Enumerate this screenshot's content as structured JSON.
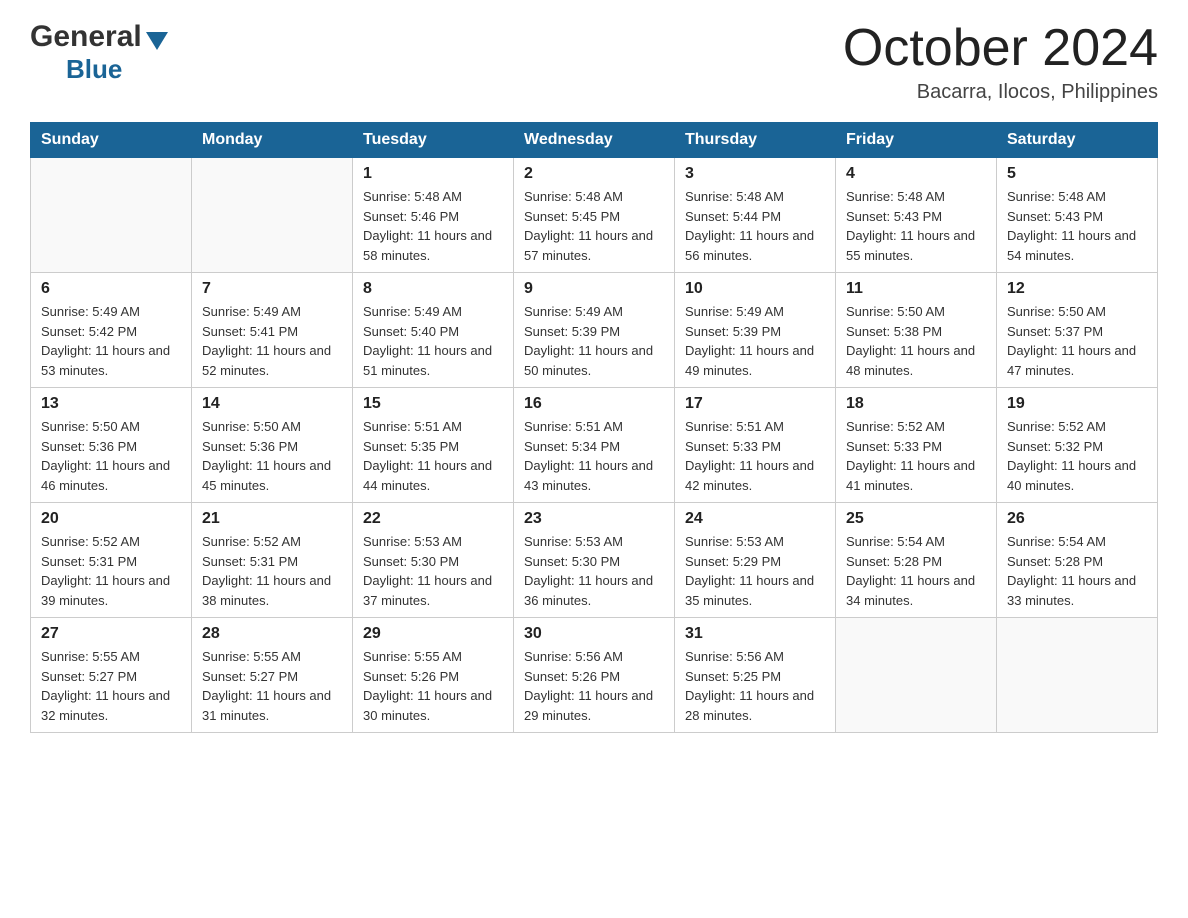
{
  "header": {
    "logo": {
      "general": "General",
      "blue": "Blue",
      "triangle_color": "#1a6496"
    },
    "title": "October 2024",
    "location": "Bacarra, Ilocos, Philippines"
  },
  "calendar": {
    "header_color": "#1a6496",
    "days": [
      "Sunday",
      "Monday",
      "Tuesday",
      "Wednesday",
      "Thursday",
      "Friday",
      "Saturday"
    ],
    "weeks": [
      [
        {
          "day": "",
          "sunrise": "",
          "sunset": "",
          "daylight": ""
        },
        {
          "day": "",
          "sunrise": "",
          "sunset": "",
          "daylight": ""
        },
        {
          "day": "1",
          "sunrise": "Sunrise: 5:48 AM",
          "sunset": "Sunset: 5:46 PM",
          "daylight": "Daylight: 11 hours and 58 minutes."
        },
        {
          "day": "2",
          "sunrise": "Sunrise: 5:48 AM",
          "sunset": "Sunset: 5:45 PM",
          "daylight": "Daylight: 11 hours and 57 minutes."
        },
        {
          "day": "3",
          "sunrise": "Sunrise: 5:48 AM",
          "sunset": "Sunset: 5:44 PM",
          "daylight": "Daylight: 11 hours and 56 minutes."
        },
        {
          "day": "4",
          "sunrise": "Sunrise: 5:48 AM",
          "sunset": "Sunset: 5:43 PM",
          "daylight": "Daylight: 11 hours and 55 minutes."
        },
        {
          "day": "5",
          "sunrise": "Sunrise: 5:48 AM",
          "sunset": "Sunset: 5:43 PM",
          "daylight": "Daylight: 11 hours and 54 minutes."
        }
      ],
      [
        {
          "day": "6",
          "sunrise": "Sunrise: 5:49 AM",
          "sunset": "Sunset: 5:42 PM",
          "daylight": "Daylight: 11 hours and 53 minutes."
        },
        {
          "day": "7",
          "sunrise": "Sunrise: 5:49 AM",
          "sunset": "Sunset: 5:41 PM",
          "daylight": "Daylight: 11 hours and 52 minutes."
        },
        {
          "day": "8",
          "sunrise": "Sunrise: 5:49 AM",
          "sunset": "Sunset: 5:40 PM",
          "daylight": "Daylight: 11 hours and 51 minutes."
        },
        {
          "day": "9",
          "sunrise": "Sunrise: 5:49 AM",
          "sunset": "Sunset: 5:39 PM",
          "daylight": "Daylight: 11 hours and 50 minutes."
        },
        {
          "day": "10",
          "sunrise": "Sunrise: 5:49 AM",
          "sunset": "Sunset: 5:39 PM",
          "daylight": "Daylight: 11 hours and 49 minutes."
        },
        {
          "day": "11",
          "sunrise": "Sunrise: 5:50 AM",
          "sunset": "Sunset: 5:38 PM",
          "daylight": "Daylight: 11 hours and 48 minutes."
        },
        {
          "day": "12",
          "sunrise": "Sunrise: 5:50 AM",
          "sunset": "Sunset: 5:37 PM",
          "daylight": "Daylight: 11 hours and 47 minutes."
        }
      ],
      [
        {
          "day": "13",
          "sunrise": "Sunrise: 5:50 AM",
          "sunset": "Sunset: 5:36 PM",
          "daylight": "Daylight: 11 hours and 46 minutes."
        },
        {
          "day": "14",
          "sunrise": "Sunrise: 5:50 AM",
          "sunset": "Sunset: 5:36 PM",
          "daylight": "Daylight: 11 hours and 45 minutes."
        },
        {
          "day": "15",
          "sunrise": "Sunrise: 5:51 AM",
          "sunset": "Sunset: 5:35 PM",
          "daylight": "Daylight: 11 hours and 44 minutes."
        },
        {
          "day": "16",
          "sunrise": "Sunrise: 5:51 AM",
          "sunset": "Sunset: 5:34 PM",
          "daylight": "Daylight: 11 hours and 43 minutes."
        },
        {
          "day": "17",
          "sunrise": "Sunrise: 5:51 AM",
          "sunset": "Sunset: 5:33 PM",
          "daylight": "Daylight: 11 hours and 42 minutes."
        },
        {
          "day": "18",
          "sunrise": "Sunrise: 5:52 AM",
          "sunset": "Sunset: 5:33 PM",
          "daylight": "Daylight: 11 hours and 41 minutes."
        },
        {
          "day": "19",
          "sunrise": "Sunrise: 5:52 AM",
          "sunset": "Sunset: 5:32 PM",
          "daylight": "Daylight: 11 hours and 40 minutes."
        }
      ],
      [
        {
          "day": "20",
          "sunrise": "Sunrise: 5:52 AM",
          "sunset": "Sunset: 5:31 PM",
          "daylight": "Daylight: 11 hours and 39 minutes."
        },
        {
          "day": "21",
          "sunrise": "Sunrise: 5:52 AM",
          "sunset": "Sunset: 5:31 PM",
          "daylight": "Daylight: 11 hours and 38 minutes."
        },
        {
          "day": "22",
          "sunrise": "Sunrise: 5:53 AM",
          "sunset": "Sunset: 5:30 PM",
          "daylight": "Daylight: 11 hours and 37 minutes."
        },
        {
          "day": "23",
          "sunrise": "Sunrise: 5:53 AM",
          "sunset": "Sunset: 5:30 PM",
          "daylight": "Daylight: 11 hours and 36 minutes."
        },
        {
          "day": "24",
          "sunrise": "Sunrise: 5:53 AM",
          "sunset": "Sunset: 5:29 PM",
          "daylight": "Daylight: 11 hours and 35 minutes."
        },
        {
          "day": "25",
          "sunrise": "Sunrise: 5:54 AM",
          "sunset": "Sunset: 5:28 PM",
          "daylight": "Daylight: 11 hours and 34 minutes."
        },
        {
          "day": "26",
          "sunrise": "Sunrise: 5:54 AM",
          "sunset": "Sunset: 5:28 PM",
          "daylight": "Daylight: 11 hours and 33 minutes."
        }
      ],
      [
        {
          "day": "27",
          "sunrise": "Sunrise: 5:55 AM",
          "sunset": "Sunset: 5:27 PM",
          "daylight": "Daylight: 11 hours and 32 minutes."
        },
        {
          "day": "28",
          "sunrise": "Sunrise: 5:55 AM",
          "sunset": "Sunset: 5:27 PM",
          "daylight": "Daylight: 11 hours and 31 minutes."
        },
        {
          "day": "29",
          "sunrise": "Sunrise: 5:55 AM",
          "sunset": "Sunset: 5:26 PM",
          "daylight": "Daylight: 11 hours and 30 minutes."
        },
        {
          "day": "30",
          "sunrise": "Sunrise: 5:56 AM",
          "sunset": "Sunset: 5:26 PM",
          "daylight": "Daylight: 11 hours and 29 minutes."
        },
        {
          "day": "31",
          "sunrise": "Sunrise: 5:56 AM",
          "sunset": "Sunset: 5:25 PM",
          "daylight": "Daylight: 11 hours and 28 minutes."
        },
        {
          "day": "",
          "sunrise": "",
          "sunset": "",
          "daylight": ""
        },
        {
          "day": "",
          "sunrise": "",
          "sunset": "",
          "daylight": ""
        }
      ]
    ]
  }
}
